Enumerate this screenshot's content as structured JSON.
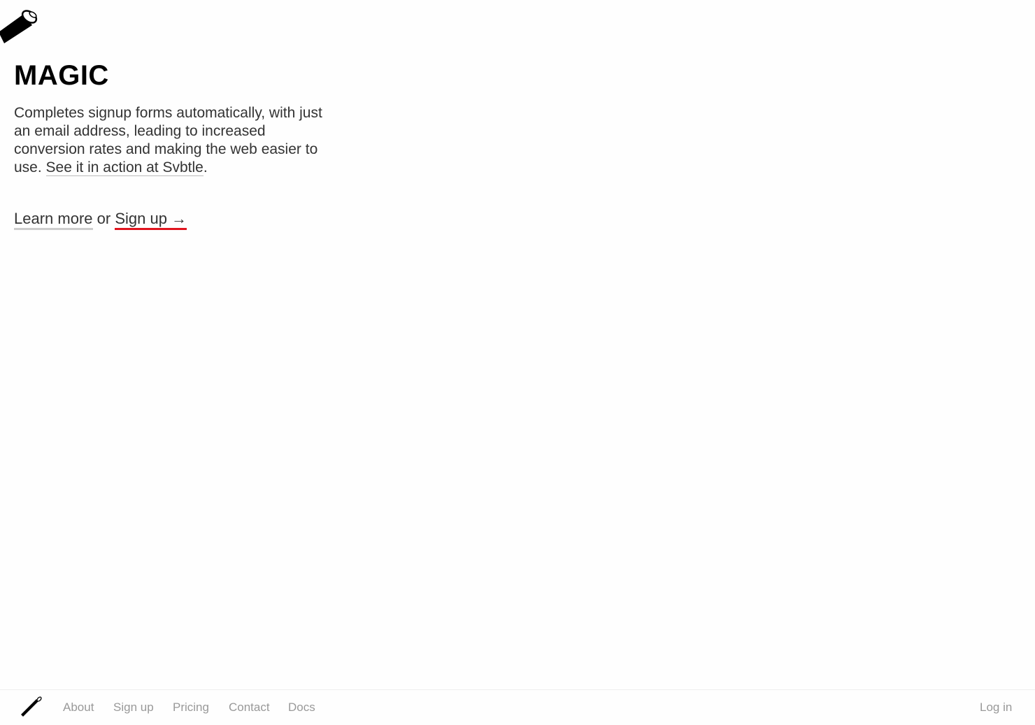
{
  "brand": {
    "title": "MAGIC",
    "logo_icon": "magic-wand-icon"
  },
  "intro": {
    "text": "Completes signup forms automatically, with just an email address, leading to increased conversion rates and making the web easier to use.",
    "link_text": "See it in action at Svbtle",
    "after_link": "."
  },
  "cta": {
    "learn_more": "Learn more",
    "or": "or",
    "sign_up": "Sign up →",
    "accent_color": "#e0141e"
  },
  "footer": {
    "logo_icon": "magic-wand-icon",
    "nav": {
      "about": "About",
      "sign_up": "Sign up",
      "pricing": "Pricing",
      "contact": "Contact",
      "docs": "Docs"
    },
    "login": "Log in"
  }
}
